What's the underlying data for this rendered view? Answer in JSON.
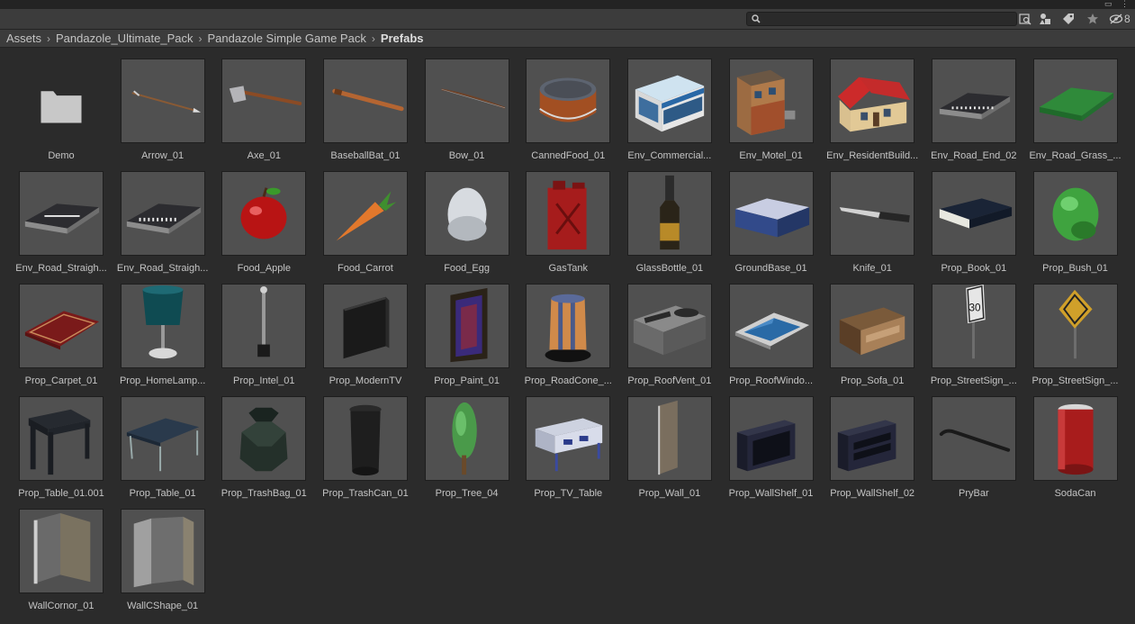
{
  "search": {
    "placeholder": "",
    "value": ""
  },
  "toolbar": {
    "hidden_count": "8"
  },
  "breadcrumb": [
    "Assets",
    "Pandazole_Ultimate_Pack",
    "Pandazole Simple Game Pack",
    "Prefabs"
  ],
  "assets": [
    {
      "label": "Demo",
      "icon": "folder-icon"
    },
    {
      "label": "Arrow_01",
      "icon": "arrow-icon"
    },
    {
      "label": "Axe_01",
      "icon": "axe-icon"
    },
    {
      "label": "BaseballBat_01",
      "icon": "baseball-bat-icon"
    },
    {
      "label": "Bow_01",
      "icon": "bow-icon"
    },
    {
      "label": "CannedFood_01",
      "icon": "canned-food-icon"
    },
    {
      "label": "Env_Commercial...",
      "icon": "commercial-building-icon"
    },
    {
      "label": "Env_Motel_01",
      "icon": "motel-icon"
    },
    {
      "label": "Env_ResidentBuild...",
      "icon": "house-icon"
    },
    {
      "label": "Env_Road_End_02",
      "icon": "road-end-icon"
    },
    {
      "label": "Env_Road_Grass_...",
      "icon": "road-grass-icon"
    },
    {
      "label": "Env_Road_Straigh...",
      "icon": "road-straight-icon"
    },
    {
      "label": "Env_Road_Straigh...",
      "icon": "road-straight-crosswalk-icon"
    },
    {
      "label": "Food_Apple",
      "icon": "apple-icon"
    },
    {
      "label": "Food_Carrot",
      "icon": "carrot-icon"
    },
    {
      "label": "Food_Egg",
      "icon": "egg-icon"
    },
    {
      "label": "GasTank",
      "icon": "gas-tank-icon"
    },
    {
      "label": "GlassBottle_01",
      "icon": "bottle-icon"
    },
    {
      "label": "GroundBase_01",
      "icon": "ground-base-icon"
    },
    {
      "label": "Knife_01",
      "icon": "knife-icon"
    },
    {
      "label": "Prop_Book_01",
      "icon": "book-icon"
    },
    {
      "label": "Prop_Bush_01",
      "icon": "bush-icon"
    },
    {
      "label": "Prop_Carpet_01",
      "icon": "carpet-icon"
    },
    {
      "label": "Prop_HomeLamp...",
      "icon": "lamp-icon"
    },
    {
      "label": "Prop_Intel_01",
      "icon": "intel-pole-icon"
    },
    {
      "label": "Prop_ModernTV",
      "icon": "tv-icon"
    },
    {
      "label": "Prop_Paint_01",
      "icon": "painting-icon"
    },
    {
      "label": "Prop_RoadCone_...",
      "icon": "road-cone-icon"
    },
    {
      "label": "Prop_RoofVent_01",
      "icon": "roof-vent-icon"
    },
    {
      "label": "Prop_RoofWindo...",
      "icon": "roof-window-icon"
    },
    {
      "label": "Prop_Sofa_01",
      "icon": "sofa-icon"
    },
    {
      "label": "Prop_StreetSign_...",
      "icon": "street-sign-icon"
    },
    {
      "label": "Prop_StreetSign_...",
      "icon": "street-sign-diamond-icon"
    },
    {
      "label": "Prop_Table_01.001",
      "icon": "table-icon"
    },
    {
      "label": "Prop_Table_01",
      "icon": "coffee-table-icon"
    },
    {
      "label": "Prop_TrashBag_01",
      "icon": "trash-bag-icon"
    },
    {
      "label": "Prop_TrashCan_01",
      "icon": "trash-can-icon"
    },
    {
      "label": "Prop_Tree_04",
      "icon": "tree-icon"
    },
    {
      "label": "Prop_TV_Table",
      "icon": "tv-table-icon"
    },
    {
      "label": "Prop_Wall_01",
      "icon": "wall-icon"
    },
    {
      "label": "Prop_WallShelf_01",
      "icon": "wall-shelf-icon"
    },
    {
      "label": "Prop_WallShelf_02",
      "icon": "wall-shelf-2-icon"
    },
    {
      "label": "PryBar",
      "icon": "pry-bar-icon"
    },
    {
      "label": "SodaCan",
      "icon": "soda-can-icon"
    },
    {
      "label": "WallCornor_01",
      "icon": "wall-corner-icon"
    },
    {
      "label": "WallCShape_01",
      "icon": "wall-c-shape-icon"
    }
  ]
}
